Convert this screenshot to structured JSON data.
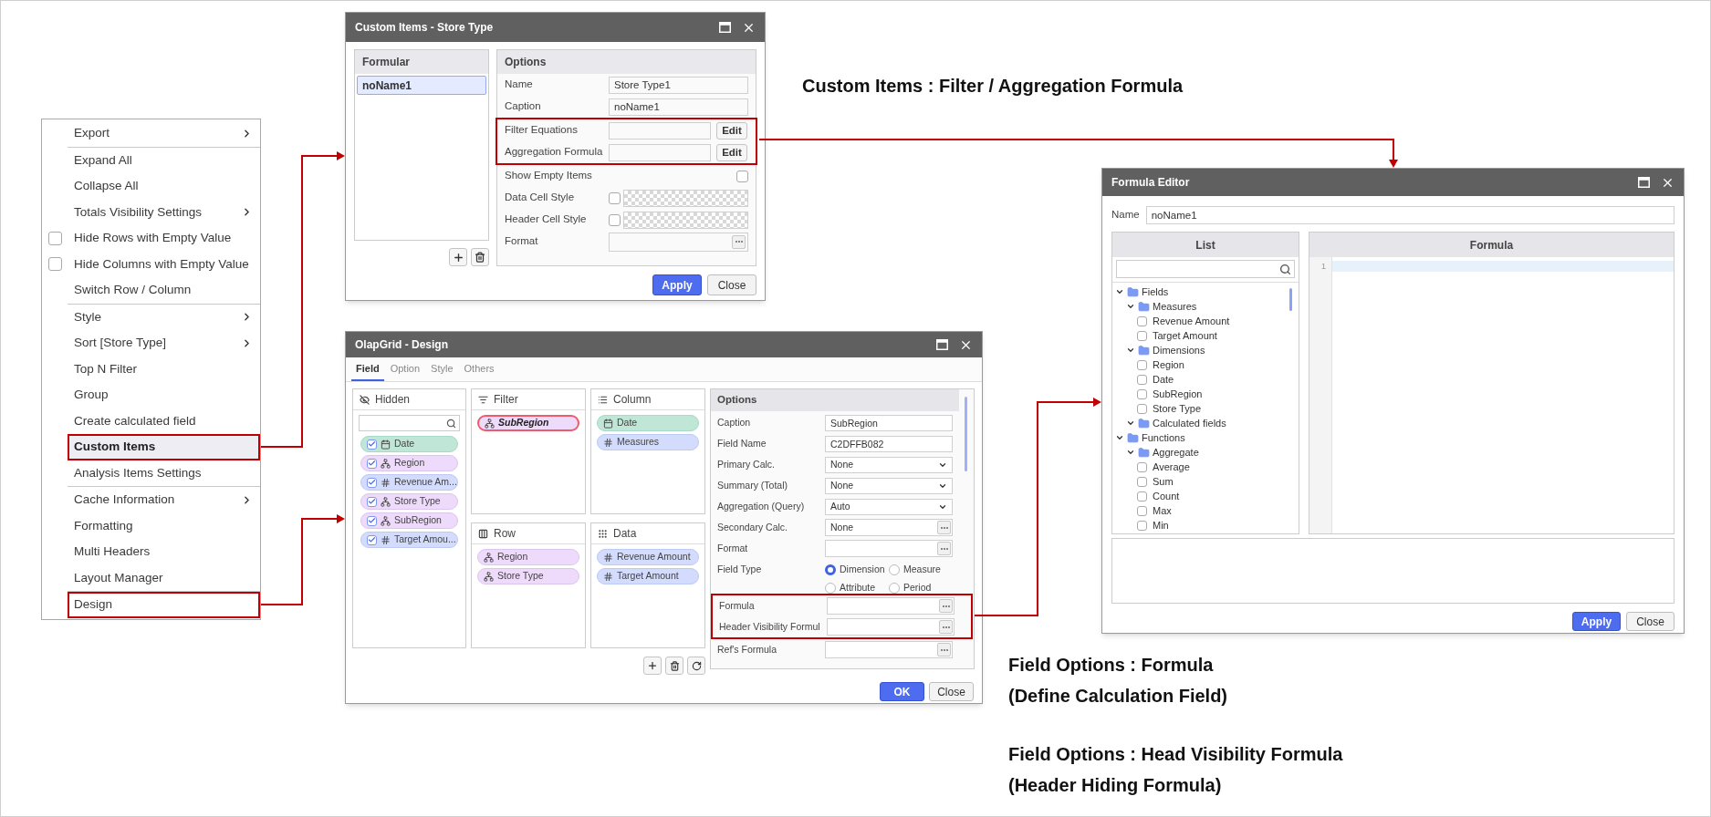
{
  "context_menu": {
    "groups": [
      {
        "items": [
          {
            "label": "Export",
            "kind": "submenu",
            "selected": false,
            "highlighted": false
          }
        ]
      },
      {
        "items": [
          {
            "label": "Expand All",
            "kind": "plain",
            "selected": false,
            "highlighted": false
          },
          {
            "label": "Collapse All",
            "kind": "plain",
            "selected": false,
            "highlighted": false
          },
          {
            "label": "Totals Visibility Settings",
            "kind": "submenu",
            "selected": false,
            "highlighted": false
          },
          {
            "label": "Hide Rows with Empty Value",
            "kind": "checkbox",
            "checked": false,
            "selected": false,
            "highlighted": false
          },
          {
            "label": "Hide Columns with Empty Value",
            "kind": "checkbox",
            "checked": false,
            "selected": false,
            "highlighted": false
          },
          {
            "label": "Switch Row / Column",
            "kind": "plain",
            "selected": false,
            "highlighted": false
          }
        ]
      },
      {
        "items": [
          {
            "label": "Style",
            "kind": "submenu",
            "selected": false,
            "highlighted": false
          },
          {
            "label": "Sort [Store Type]",
            "kind": "submenu",
            "selected": false,
            "highlighted": false
          },
          {
            "label": "Top N Filter",
            "kind": "plain",
            "selected": false,
            "highlighted": false
          },
          {
            "label": "Group",
            "kind": "plain",
            "selected": false,
            "highlighted": false
          },
          {
            "label": "Create calculated field",
            "kind": "plain",
            "selected": false,
            "highlighted": false
          },
          {
            "label": "Custom Items",
            "kind": "plain",
            "selected": true,
            "highlighted": true
          },
          {
            "label": "Analysis Items Settings",
            "kind": "plain",
            "selected": false,
            "highlighted": false
          }
        ]
      },
      {
        "items": [
          {
            "label": "Cache Information",
            "kind": "submenu",
            "selected": false,
            "highlighted": false
          },
          {
            "label": "Formatting",
            "kind": "plain",
            "selected": false,
            "highlighted": false
          },
          {
            "label": "Multi Headers",
            "kind": "plain",
            "selected": false,
            "highlighted": false
          },
          {
            "label": "Layout Manager",
            "kind": "plain",
            "selected": false,
            "highlighted": false
          }
        ]
      },
      {
        "items": [
          {
            "label": "Design",
            "kind": "plain",
            "selected": false,
            "highlighted": true
          }
        ]
      }
    ]
  },
  "custom_items_dialog": {
    "title": "Custom Items - Store Type",
    "formular": {
      "header": "Formular",
      "items": [
        {
          "label": "noName1",
          "selected": true
        }
      ]
    },
    "options": {
      "header": "Options",
      "rows": [
        {
          "kind": "text",
          "label": "Name",
          "value": "Store Type1"
        },
        {
          "kind": "text",
          "label": "Caption",
          "value": "noName1"
        },
        {
          "kind": "edit",
          "label": "Filter Equations",
          "button": "Edit",
          "highlighted": true
        },
        {
          "kind": "edit",
          "label": "Aggregation Formula",
          "button": "Edit",
          "highlighted": true
        },
        {
          "kind": "checkbox",
          "label": "Show Empty Items",
          "checked": false
        },
        {
          "kind": "style",
          "label": "Data Cell Style",
          "checked": false
        },
        {
          "kind": "style",
          "label": "Header Cell Style",
          "checked": false
        },
        {
          "kind": "ellipsis",
          "label": "Format"
        }
      ]
    },
    "buttons": [
      {
        "label": "Apply",
        "primary": true
      },
      {
        "label": "Close",
        "primary": false
      }
    ]
  },
  "design_dialog": {
    "title": "OlapGrid - Design",
    "tabs": [
      {
        "label": "Field",
        "selected": true
      },
      {
        "label": "Option",
        "selected": false
      },
      {
        "label": "Style",
        "selected": false
      },
      {
        "label": "Others",
        "selected": false
      }
    ],
    "hidden": {
      "title": "Hidden",
      "fields": [
        {
          "label": "Date",
          "kind": "date",
          "checked": true,
          "selected": false
        },
        {
          "label": "Region",
          "kind": "dimension",
          "checked": true,
          "selected": false
        },
        {
          "label": "Revenue Am...",
          "kind": "measure",
          "checked": true,
          "selected": false
        },
        {
          "label": "Store Type",
          "kind": "dimension",
          "checked": true,
          "selected": false
        },
        {
          "label": "SubRegion",
          "kind": "dimension",
          "checked": true,
          "selected": false
        },
        {
          "label": "Target Amou...",
          "kind": "measure",
          "checked": true,
          "selected": false
        }
      ]
    },
    "filter": {
      "title": "Filter",
      "fields": [
        {
          "label": "SubRegion",
          "kind": "dimension",
          "selected": true
        }
      ]
    },
    "column": {
      "title": "Column",
      "fields": [
        {
          "label": "Date",
          "kind": "date",
          "selected": false
        },
        {
          "label": "Measures",
          "kind": "measure",
          "selected": false
        }
      ]
    },
    "row": {
      "title": "Row",
      "fields": [
        {
          "label": "Region",
          "kind": "dimension",
          "selected": false
        },
        {
          "label": "Store Type",
          "kind": "dimension",
          "selected": false
        }
      ]
    },
    "data": {
      "title": "Data",
      "fields": [
        {
          "label": "Revenue Amount",
          "kind": "measure",
          "selected": false
        },
        {
          "label": "Target Amount",
          "kind": "measure",
          "selected": false
        }
      ]
    },
    "options": {
      "header": "Options",
      "rows": [
        {
          "kind": "text",
          "label": "Caption",
          "value": "SubRegion"
        },
        {
          "kind": "text",
          "label": "Field Name",
          "value": "C2DFFB082"
        },
        {
          "kind": "select",
          "label": "Primary Calc.",
          "value": "None"
        },
        {
          "kind": "select",
          "label": "Summary (Total)",
          "value": "None"
        },
        {
          "kind": "select",
          "label": "Aggregation (Query)",
          "value": "Auto"
        },
        {
          "kind": "ellipsis",
          "label": "Secondary Calc.",
          "value": "None"
        },
        {
          "kind": "ellipsis",
          "label": "Format"
        },
        {
          "kind": "radio",
          "label": "Field Type",
          "options": [
            {
              "label": "Dimension",
              "selected": true
            },
            {
              "label": "Measure",
              "selected": false
            },
            {
              "label": "Attribute",
              "selected": false
            },
            {
              "label": "Period",
              "selected": false
            }
          ]
        },
        {
          "kind": "ellipsis",
          "label": "Formula",
          "highlighted": true
        },
        {
          "kind": "ellipsis",
          "label": "Header Visibility Formul",
          "highlighted": true
        },
        {
          "kind": "ellipsis",
          "label": "Ref's Formula"
        }
      ]
    },
    "buttons": [
      {
        "label": "OK",
        "primary": true
      },
      {
        "label": "Close",
        "primary": false
      }
    ]
  },
  "formula_editor": {
    "title": "Formula Editor",
    "name": {
      "label": "Name",
      "value": "noName1"
    },
    "list": {
      "header": "List",
      "tree": [
        {
          "label": "Fields",
          "kind": "folder",
          "expanded": true,
          "children": [
            {
              "label": "Measures",
              "kind": "folder",
              "expanded": true,
              "children": [
                {
                  "label": "Revenue Amount",
                  "kind": "item",
                  "checked": false
                },
                {
                  "label": "Target Amount",
                  "kind": "item",
                  "checked": false
                }
              ]
            },
            {
              "label": "Dimensions",
              "kind": "folder",
              "expanded": true,
              "children": [
                {
                  "label": "Region",
                  "kind": "item",
                  "checked": false
                },
                {
                  "label": "Date",
                  "kind": "item",
                  "checked": false
                },
                {
                  "label": "SubRegion",
                  "kind": "item",
                  "checked": false
                },
                {
                  "label": "Store Type",
                  "kind": "item",
                  "checked": false
                }
              ]
            },
            {
              "label": "Calculated fields",
              "kind": "folder",
              "expanded": true
            }
          ]
        },
        {
          "label": "Functions",
          "kind": "folder",
          "expanded": true,
          "children": [
            {
              "label": "Aggregate",
              "kind": "folder",
              "expanded": true,
              "children": [
                {
                  "label": "Average",
                  "kind": "item",
                  "checked": false
                },
                {
                  "label": "Sum",
                  "kind": "item",
                  "checked": false
                },
                {
                  "label": "Count",
                  "kind": "item",
                  "checked": false
                },
                {
                  "label": "Max",
                  "kind": "item",
                  "checked": false
                },
                {
                  "label": "Min",
                  "kind": "item",
                  "checked": false
                }
              ]
            }
          ]
        }
      ]
    },
    "formula": {
      "header": "Formula",
      "line_numbers": [
        "1"
      ]
    },
    "buttons": [
      {
        "label": "Apply",
        "primary": true
      },
      {
        "label": "Close",
        "primary": false
      }
    ]
  },
  "annotations": [
    {
      "lines": [
        "Custom Items : Filter / Aggregation Formula"
      ]
    },
    {
      "lines": [
        "Field Options : Formula",
        "(Define Calculation Field)"
      ]
    },
    {
      "lines": [
        "Field Options : Head Visibility Formula",
        "(Header Hiding Formula)"
      ]
    }
  ]
}
